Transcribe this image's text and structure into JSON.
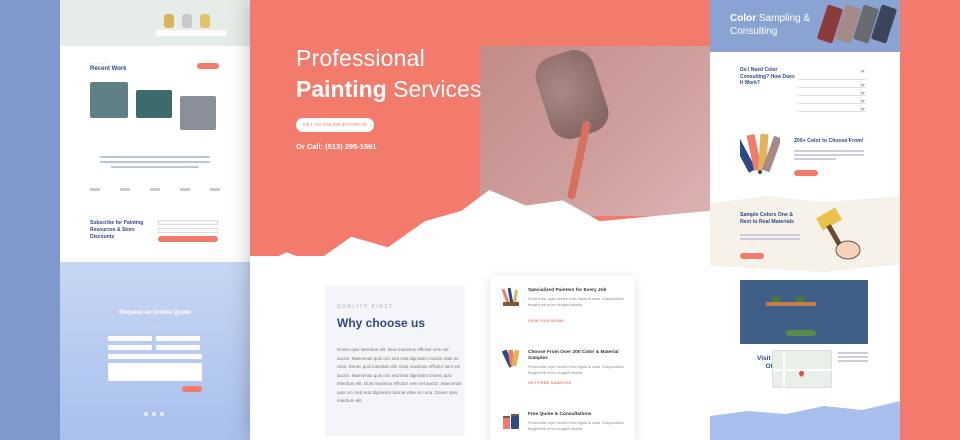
{
  "hero": {
    "title_line1": "Professional",
    "title_bold": "Painting",
    "title_rest": " Services",
    "cta": "GET AN ONLINE ESTIMATE",
    "call": "Or Call: (513) 295-1561"
  },
  "why": {
    "eyebrow": "QUALITY FIRST",
    "title": "Why choose us",
    "body": "Donec quis interdum elit. Duis maximus efficitur sem vel auctor. Maecenas quis orci sed erat dignissim lacinia vitae ac urna. Donec quis interdum elit. Duis maximus efficitur sem vel auctor. Maecenas quis orci sed erat dignissim Donec quis interdum elit. Duis maximus efficitur sem vel auctor. Maecenas quis orci sed erat dignissim lacinia vitae ac urna. Donec quis interdum elit."
  },
  "features": [
    {
      "title": "Specialized Painters for Every Job",
      "desc": "Porta nulla, eget ornare enim ligula id nulla. Suspendisse fringilla est et leo feugiat lobortis.",
      "link": "VIEW OUR WORK"
    },
    {
      "title": "Choose From Over 200 Color & Material Samples",
      "desc": "Porta nulla, eget ornare enim ligula id nulla. Suspendisse fringilla est et leo feugiat lobortis.",
      "link": "GET FREE SAMPLES"
    },
    {
      "title": "Free Quote & Consultations",
      "desc": "Porta nulla, eget ornare enim ligula id nulla. Suspendisse fringilla est et leo feugiat lobortis.",
      "link": ""
    }
  ],
  "left_page": {
    "recent_work": "Recent Work",
    "subscribe_title": "Subscribe for Painting Resources & Store Discounts",
    "request_title": "Request an Online Quote"
  },
  "right_page": {
    "title_bold": "Color",
    "title_rest": " Sampling & Consulting",
    "faq_q": "Do I Need Color Consulting? How Does It Work?",
    "colors_title": "200+ Color to Choose From!",
    "samples_title": "Sample Colors One & Next to Real Materials",
    "visit": "Visit Our Office"
  },
  "colors": {
    "accent": "#f27b6b",
    "navy": "#2e4a86",
    "blue": "#7f99cc"
  }
}
